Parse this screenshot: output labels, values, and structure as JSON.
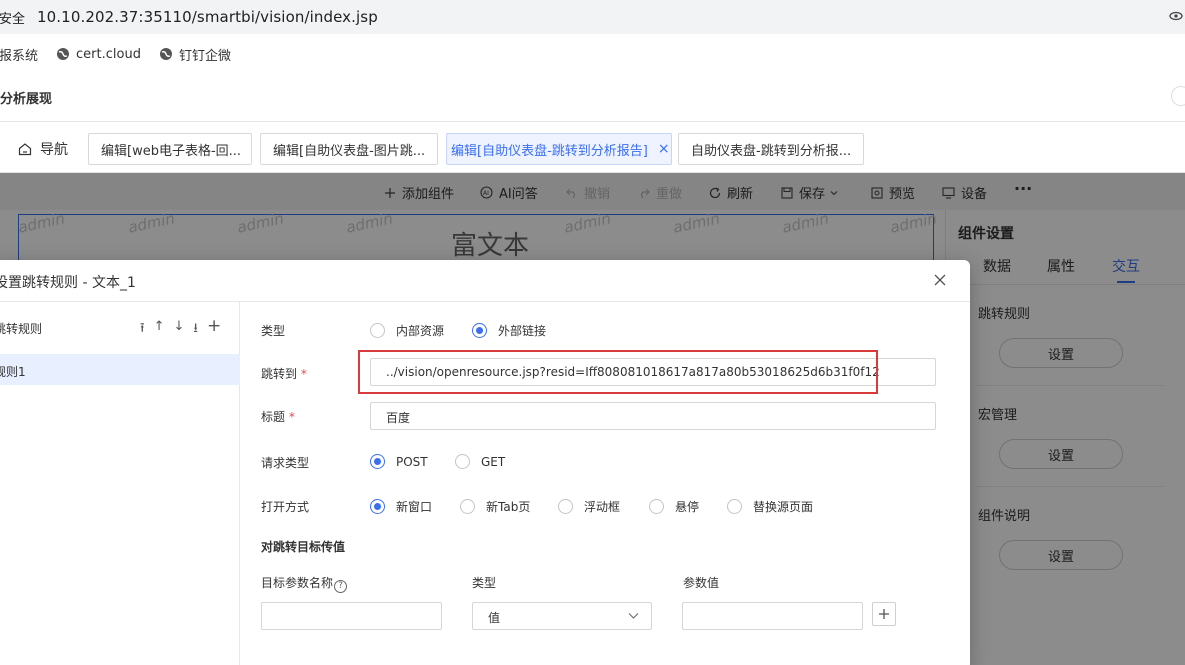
{
  "browser": {
    "security_label": "安全",
    "url": "10.10.202.37:35110/smartbi/vision/index.jsp",
    "bookmarks": [
      "报系统",
      "cert.cloud",
      "钉钉企微"
    ]
  },
  "app": {
    "title": "分析展现",
    "nav_label": "导航",
    "tabs": [
      {
        "label": "编辑[web电子表格-回..."
      },
      {
        "label": "编辑[自助仪表盘-图片跳..."
      },
      {
        "label": "编辑[自助仪表盘-跳转到分析报告]",
        "close": "×"
      },
      {
        "label": "自助仪表盘-跳转到分析报..."
      }
    ]
  },
  "toolbar": {
    "add_component": "添加组件",
    "ai_qa": "AI问答",
    "undo": "撤销",
    "redo": "重做",
    "refresh": "刷新",
    "save": "保存",
    "preview": "预览",
    "device": "设备",
    "more": "···"
  },
  "canvas": {
    "rich_text_title": "富文本",
    "watermark": "admin",
    "collapse": "»"
  },
  "right_panel": {
    "title": "组件设置",
    "tabs": [
      "数据",
      "属性",
      "交互"
    ],
    "active_tab": "交互",
    "sections": [
      {
        "label": "跳转规则",
        "button": "设置"
      },
      {
        "label": "宏管理",
        "button": "设置"
      },
      {
        "label": "组件说明",
        "button": "设置"
      }
    ]
  },
  "dialog": {
    "title": "设置跳转规则 - 文本_1",
    "left": {
      "header": "跳转规则",
      "icons": [
        "⭱",
        "↑",
        "↓",
        "⭳",
        "+"
      ],
      "rules": [
        "规则1"
      ]
    },
    "form": {
      "type_label": "类型",
      "type_options": [
        "内部资源",
        "外部链接"
      ],
      "type_selected": "外部链接",
      "jump_label": "跳转到",
      "jump_value": "../vision/openresource.jsp?resid=Iff808081018617a817a80b53018625d6b31f0f12",
      "caption_label": "标题",
      "caption_value": "百度",
      "request_label": "请求类型",
      "request_options": [
        "POST",
        "GET"
      ],
      "request_selected": "POST",
      "open_label": "打开方式",
      "open_options": [
        "新窗口",
        "新Tab页",
        "浮动框",
        "悬停",
        "替换源页面"
      ],
      "open_selected": "新窗口",
      "param_heading": "对跳转目标传值",
      "param_name_label": "目标参数名称",
      "param_type_label": "类型",
      "param_value_label": "参数值",
      "param_type_value": "值",
      "required_mark": "*"
    }
  },
  "colors": {
    "accent": "#3a6ff0",
    "highlight_box": "#d73b3b",
    "required": "#e34d4d"
  }
}
